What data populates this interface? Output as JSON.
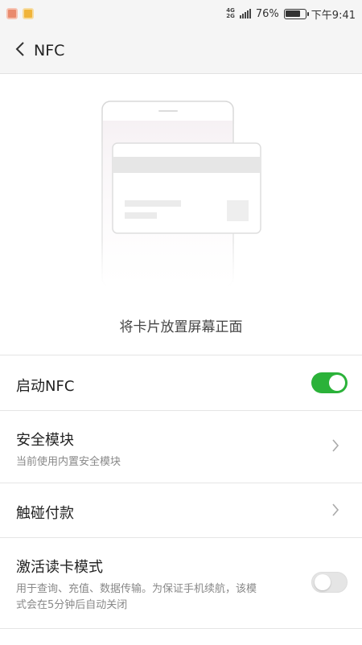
{
  "status_bar": {
    "network": "4G 4G",
    "battery_percent": "76%",
    "battery_level": 0.76,
    "time": "下午9:41"
  },
  "app_bar": {
    "title": "NFC"
  },
  "illustration": {
    "caption": "将卡片放置屏幕正面"
  },
  "settings": {
    "enable_nfc": {
      "label": "启动NFC",
      "enabled": true
    },
    "secure_element": {
      "label": "安全模块",
      "sublabel": "当前使用内置安全模块"
    },
    "tap_to_pay": {
      "label": "触碰付款"
    },
    "reader_mode": {
      "label": "激活读卡模式",
      "sublabel": "用于查询、充值、数据传输。为保证手机续航，该模式会在5分钟后自动关闭",
      "enabled": false
    }
  },
  "colors": {
    "toggle_on": "#2bb239",
    "toggle_off": "#e5e5e5",
    "bar_background": "#f5f5f5"
  },
  "icons": {
    "back": "chevron-left-icon",
    "row_arrow": "chevron-right-icon"
  }
}
